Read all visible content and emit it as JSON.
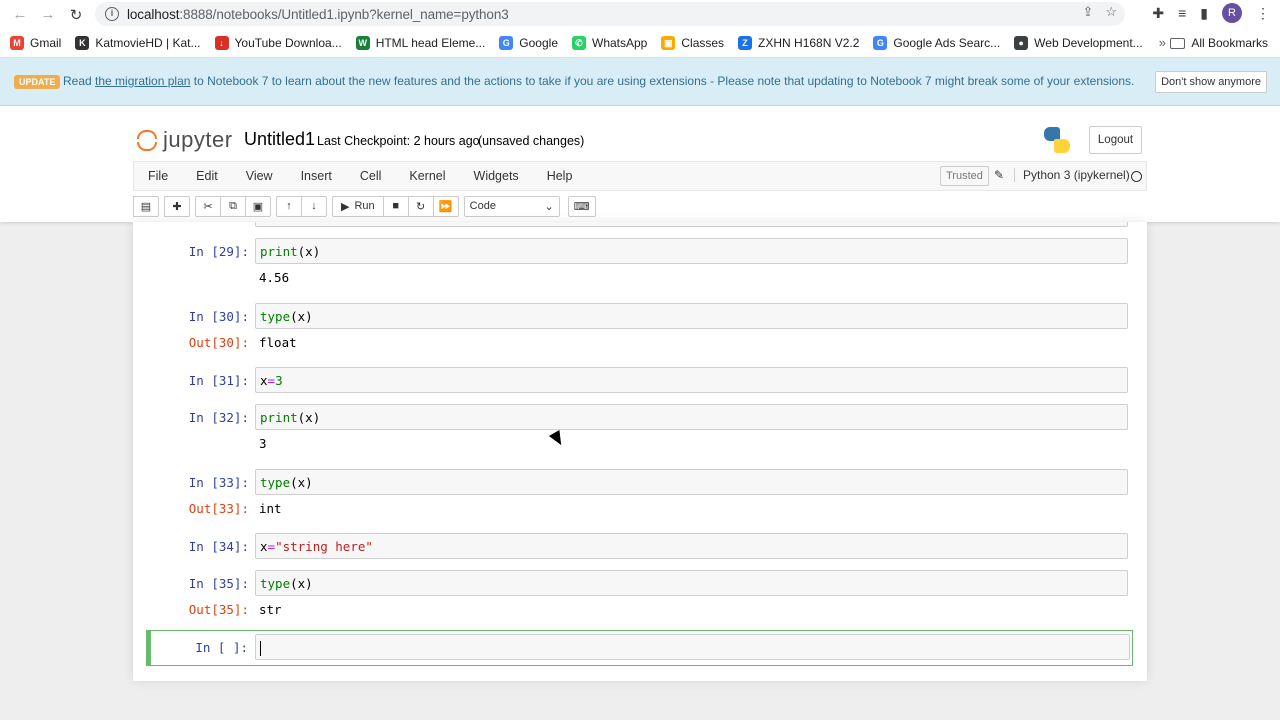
{
  "browser": {
    "url_host": "localhost",
    "url_path": ":8888/notebooks/Untitled1.ipynb?kernel_name=python3",
    "avatar_letter": "R",
    "bookmarks": [
      {
        "label": "Gmail",
        "icon": "gmail-icon",
        "color": "#ea4335",
        "glyph": "M"
      },
      {
        "label": "KatmovieHD | Kat...",
        "icon": "katmovie-icon",
        "color": "#333333",
        "glyph": "K"
      },
      {
        "label": "YouTube Downloa...",
        "icon": "youtube-downloader-icon",
        "color": "#d93025",
        "glyph": "↓"
      },
      {
        "label": "HTML head Eleme...",
        "icon": "html-head-icon",
        "color": "#188038",
        "glyph": "W"
      },
      {
        "label": "Google",
        "icon": "google-icon",
        "color": "#4285f4",
        "glyph": "G"
      },
      {
        "label": "WhatsApp",
        "icon": "whatsapp-icon",
        "color": "#25d366",
        "glyph": "✆"
      },
      {
        "label": "Classes",
        "icon": "classes-icon",
        "color": "#f9ab00",
        "glyph": "▣"
      },
      {
        "label": "ZXHN H168N V2.2",
        "icon": "zte-icon",
        "color": "#1a73e8",
        "glyph": "Z"
      },
      {
        "label": "Google Ads Searc...",
        "icon": "google-ads-icon",
        "color": "#4285f4",
        "glyph": "G"
      },
      {
        "label": "Web Development...",
        "icon": "web-development-icon",
        "color": "#3c4043",
        "glyph": "●"
      }
    ],
    "more": "»",
    "all_bookmarks": "All Bookmarks"
  },
  "banner": {
    "badge": "UPDATE",
    "read": "Read ",
    "link": "the migration plan",
    "rest": " to Notebook 7 to learn about the new features and the actions to take if you are using extensions - Please note that updating to Notebook 7 might break some of your extensions.",
    "dismiss": "Don't show anymore"
  },
  "header": {
    "logo_text": "jupyter",
    "notebook_title": "Untitled1",
    "checkpoint": "Last Checkpoint: 2 hours ago",
    "unsaved": "(unsaved changes)",
    "logout": "Logout"
  },
  "menubar": {
    "items": [
      "File",
      "Edit",
      "View",
      "Insert",
      "Cell",
      "Kernel",
      "Widgets",
      "Help"
    ],
    "trusted": "Trusted",
    "kernel": "Python 3 (ipykernel)"
  },
  "toolbar": {
    "run_label": "Run",
    "cell_type": "Code"
  },
  "cells": [
    {
      "prompt": "In [29]:",
      "code": [
        [
          "kw",
          "print"
        ],
        [
          "",
          "(x)"
        ]
      ],
      "output": "4.56",
      "out_prompt": ""
    },
    {
      "prompt": "In [30]:",
      "code": [
        [
          "kw",
          "type"
        ],
        [
          "",
          "(x)"
        ]
      ],
      "output": "float",
      "out_prompt": "Out[30]:"
    },
    {
      "prompt": "In [31]:",
      "code": [
        [
          "",
          "x"
        ],
        [
          "op",
          "="
        ],
        [
          "num",
          "3"
        ]
      ],
      "output": "",
      "out_prompt": ""
    },
    {
      "prompt": "In [32]:",
      "code": [
        [
          "kw",
          "print"
        ],
        [
          "",
          "(x)"
        ]
      ],
      "output": "3",
      "out_prompt": ""
    },
    {
      "prompt": "In [33]:",
      "code": [
        [
          "kw",
          "type"
        ],
        [
          "",
          "(x)"
        ]
      ],
      "output": "int",
      "out_prompt": "Out[33]:"
    },
    {
      "prompt": "In [34]:",
      "code": [
        [
          "",
          "x"
        ],
        [
          "op",
          "="
        ],
        [
          "str",
          "\"string here\""
        ]
      ],
      "output": "",
      "out_prompt": ""
    },
    {
      "prompt": "In [35]:",
      "code": [
        [
          "kw",
          "type"
        ],
        [
          "",
          "(x)"
        ]
      ],
      "output": "str",
      "out_prompt": "Out[35]:"
    }
  ],
  "active_cell": {
    "prompt": "In [ ]:"
  }
}
